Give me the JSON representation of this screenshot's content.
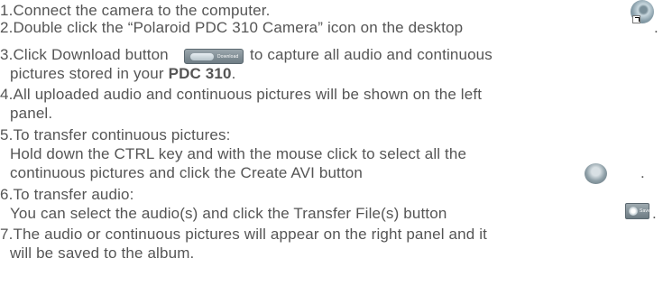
{
  "steps": [
    {
      "number": "1.",
      "text": "Connect the camera to the computer."
    },
    {
      "number": "2.",
      "text": "Double click the “Polaroid PDC 310 Camera” icon on the desktop",
      "after_icon": "."
    },
    {
      "number": "3.",
      "text": "Click Download button",
      "text_after_button": "to capture all audio and continuous",
      "line2_prefix": "pictures stored in your",
      "line2_bold": "PDC 310",
      "line2_suffix": "."
    },
    {
      "number": "4.",
      "text": "All uploaded audio and continuous pictures will be shown on the left",
      "line2": "panel."
    },
    {
      "number": "5.",
      "text": "To transfer continuous pictures:",
      "line2": "Hold down the CTRL key and with the mouse click to select all the",
      "line3": "continuous pictures and click the Create AVI button",
      "line3_end": "."
    },
    {
      "number": "6.",
      "text": "To transfer audio:",
      "line2": "You can select the audio(s) and click the Transfer File(s) button",
      "line2_end": "."
    },
    {
      "number": "7.",
      "text": "The audio or continuous pictures will appear on the right panel and it",
      "line2": "will be saved to the album."
    }
  ],
  "buttons": {
    "download_label": "Download",
    "transfer_label": "Save"
  },
  "icons": {
    "camera": "polaroid-camera-icon",
    "shortcut": "shortcut-arrow-icon",
    "download": "download-button-icon",
    "create_avi": "create-avi-icon",
    "transfer": "transfer-file-icon"
  },
  "colors": {
    "text": "#555555"
  }
}
